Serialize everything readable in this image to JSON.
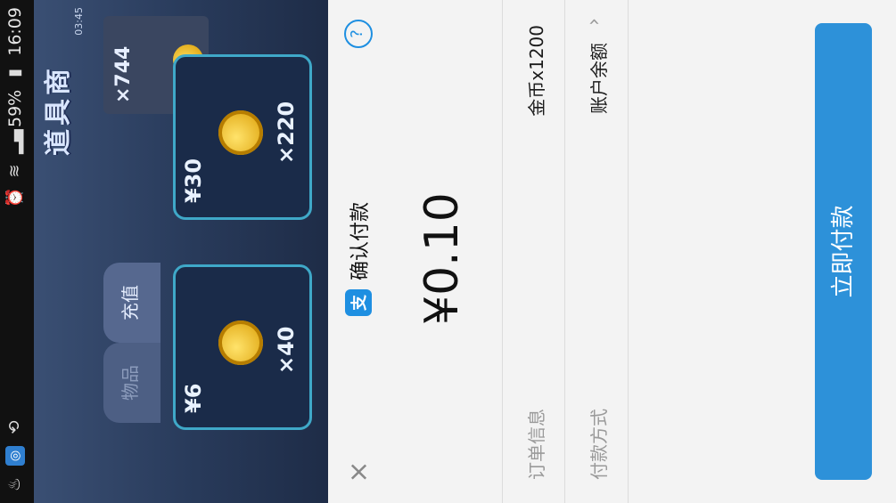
{
  "status_bar": {
    "time": "16:09",
    "battery": "59%",
    "icons": [
      "alarm-icon",
      "wifi-icon",
      "signal-icon",
      "battery-icon",
      "screen-rotate-icon",
      "app-icon",
      "notification-icon"
    ]
  },
  "game": {
    "title": "道具商",
    "timer": "03:45",
    "balance": "×744",
    "tabs": [
      {
        "label": "充值",
        "active": true
      },
      {
        "label": "物品",
        "active": false
      }
    ],
    "cards": [
      {
        "price": "¥30",
        "qty": "×220"
      },
      {
        "price": "¥6",
        "qty": "×40"
      }
    ]
  },
  "payment": {
    "title": "确认付款",
    "amount": "¥0.10",
    "order_label": "订单信息",
    "order_value": "金币x1200",
    "method_label": "付款方式",
    "method_value": "账户余额",
    "pay_button": "立即付款",
    "accent": "#2d91d9"
  }
}
